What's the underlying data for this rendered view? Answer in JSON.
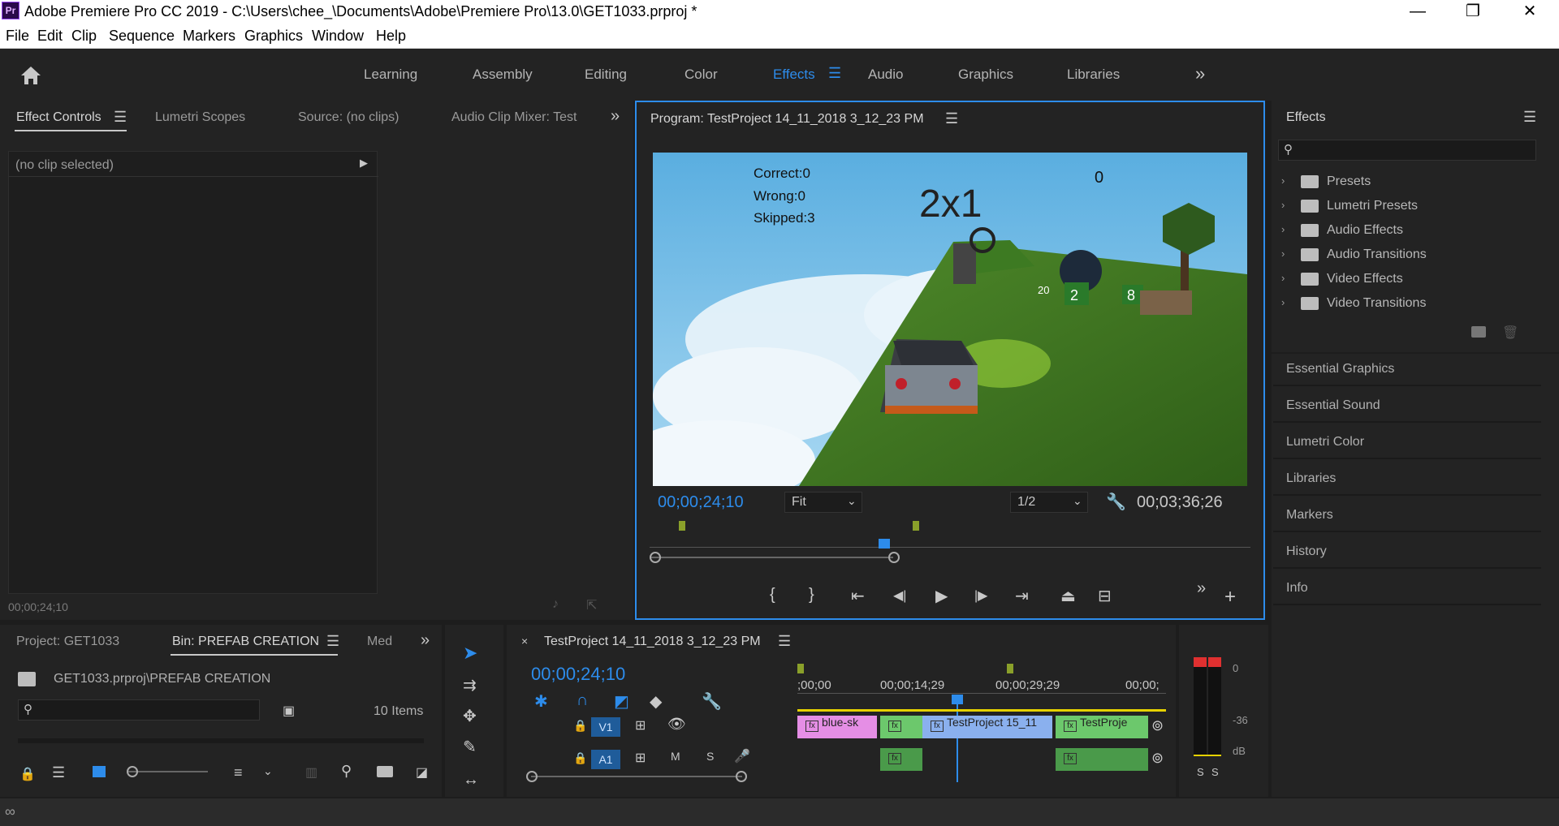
{
  "titlebar": {
    "app_icon": "Pr",
    "title": "Adobe Premiere Pro CC 2019 - C:\\Users\\chee_\\Documents\\Adobe\\Premiere Pro\\13.0\\GET1033.prproj *",
    "minimize": "—",
    "restore": "❐",
    "close": "✕"
  },
  "menu": [
    "File",
    "Edit",
    "Clip",
    "Sequence",
    "Markers",
    "Graphics",
    "Window",
    "Help"
  ],
  "workspaces": [
    "Learning",
    "Assembly",
    "Editing",
    "Color",
    "Effects",
    "Audio",
    "Graphics",
    "Libraries"
  ],
  "workspace_more": "»",
  "left_panel": {
    "tabs": [
      "Effect Controls",
      "Lumetri Scopes",
      "Source: (no clips)",
      "Audio Clip Mixer: Test"
    ],
    "no_clip": "(no clip selected)",
    "timecode": "00;00;24;10"
  },
  "program": {
    "title": "Program: TestProject 14_11_2018 3_12_23 PM",
    "game": {
      "correct": "Correct:0",
      "wrong": "Wrong:0",
      "skipped": "Skipped:3",
      "question": "2x1",
      "score": "0",
      "sign_20": "20",
      "sign_2": "2",
      "sign_8": "8"
    },
    "timecode": "00;00;24;10",
    "zoom": "Fit",
    "resolution": "1/2",
    "duration": "00;03;36;26"
  },
  "effects_panel": {
    "title": "Effects",
    "search_placeholder": "",
    "folders": [
      "Presets",
      "Lumetri Presets",
      "Audio Effects",
      "Audio Transitions",
      "Video Effects",
      "Video Transitions"
    ]
  },
  "side_panels": [
    "Essential Graphics",
    "Essential Sound",
    "Lumetri Color",
    "Libraries",
    "Markers",
    "History",
    "Info"
  ],
  "project_panel": {
    "tabs": [
      "Project: GET1033",
      "Bin: PREFAB CREATION",
      "Med"
    ],
    "path": "GET1033.prproj\\PREFAB CREATION",
    "item_count": "10 Items"
  },
  "timeline": {
    "title": "TestProject 14_11_2018 3_12_23 PM",
    "timecode": "00;00;24;10",
    "ruler": [
      ";00;00",
      "00;00;14;29",
      "00;00;29;29",
      "00;00;"
    ],
    "v1": "V1",
    "a1": "A1",
    "clips": [
      "blue-sk",
      "TestProject 15_11",
      "TestProje"
    ]
  },
  "audio_meter": {
    "labels": [
      "0",
      "-36",
      "dB"
    ],
    "solo": [
      "S",
      "S"
    ]
  },
  "colors": {
    "accent": "#2d8ceb",
    "clip_pink": "#e58ee5",
    "clip_green": "#6cc86c",
    "clip_blue": "#8ab0ee"
  }
}
